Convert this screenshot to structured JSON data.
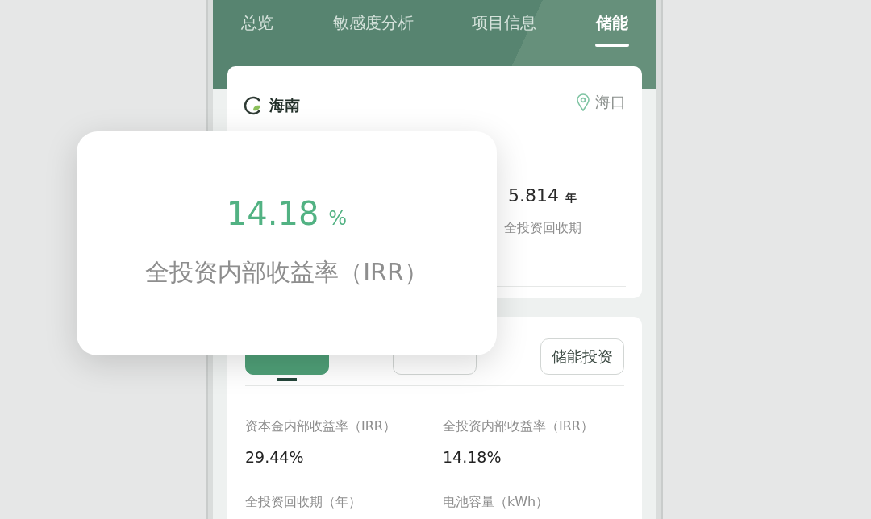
{
  "tabs": [
    {
      "label": "总览",
      "selected": false
    },
    {
      "label": "敏感度分析",
      "selected": false
    },
    {
      "label": "项目信息",
      "selected": false
    },
    {
      "label": "储能",
      "selected": true
    }
  ],
  "region_card": {
    "province": "海南",
    "city": "海口",
    "stats": [
      {
        "value": "5.814",
        "unit": "年",
        "label": "全投资回收期"
      }
    ]
  },
  "overlay": {
    "value": "14.18",
    "unit": "%",
    "label": "全投资内部收益率（IRR）"
  },
  "report": {
    "buttons": [
      {
        "selected": true
      },
      {
        "selected": false
      },
      {
        "label": "储能投资",
        "selected": false
      }
    ],
    "metrics": [
      {
        "label": "资本金内部收益率（IRR）",
        "value": "29.44%"
      },
      {
        "label": "全投资内部收益率（IRR）",
        "value": "14.18%"
      },
      {
        "label": "全投资回收期（年）"
      },
      {
        "label": "电池容量（kWh）"
      }
    ]
  }
}
